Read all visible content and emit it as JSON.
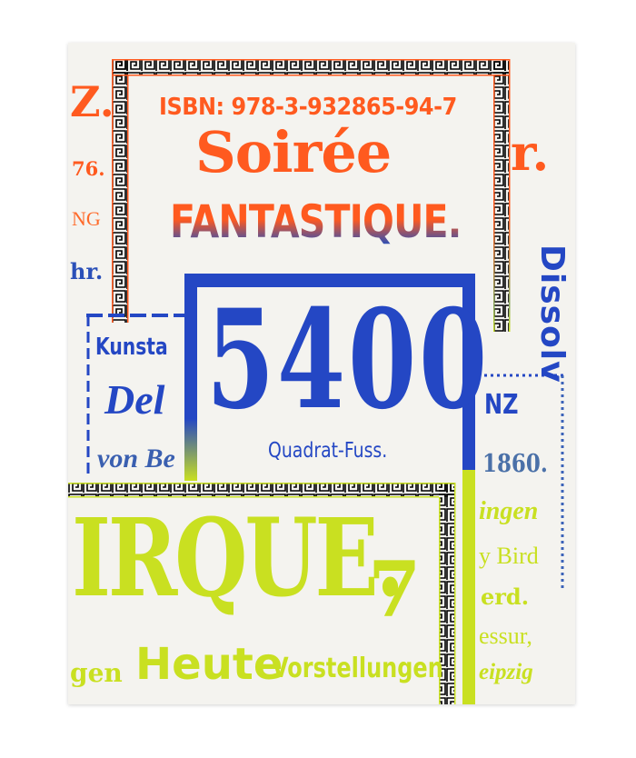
{
  "colors": {
    "orange": "#ff5a1f",
    "blue": "#2447c4",
    "lime": "#c9e021",
    "paper": "#f4f3ef"
  },
  "poster": {
    "left_column": {
      "z": "Z.",
      "n76": "76.",
      "ng": "NG",
      "hr": "hr."
    },
    "isbn": "ISBN: 978-3-932865-94-7",
    "title_script": "Soirée",
    "title_main": "FANTASTIQUE.",
    "right_r": "r.",
    "dissolv": "Dissolv",
    "left_middle": {
      "kunsta": "Kunsta",
      "del": "Del",
      "von_be": "von Be"
    },
    "big_number": "5400",
    "unit": "Quadrat-Fuss.",
    "right_middle": {
      "nz": "NZ",
      "year": "1860.",
      "ingen": "ingen",
      "bird": "y Bird",
      "erd": "erd.",
      "essur": "essur,",
      "leipzig": "eipzig"
    },
    "irque": "IRQUE.",
    "seven": "7",
    "gen": "gen",
    "heute": "Heute",
    "vorstellungen": "Vorstellungen"
  }
}
